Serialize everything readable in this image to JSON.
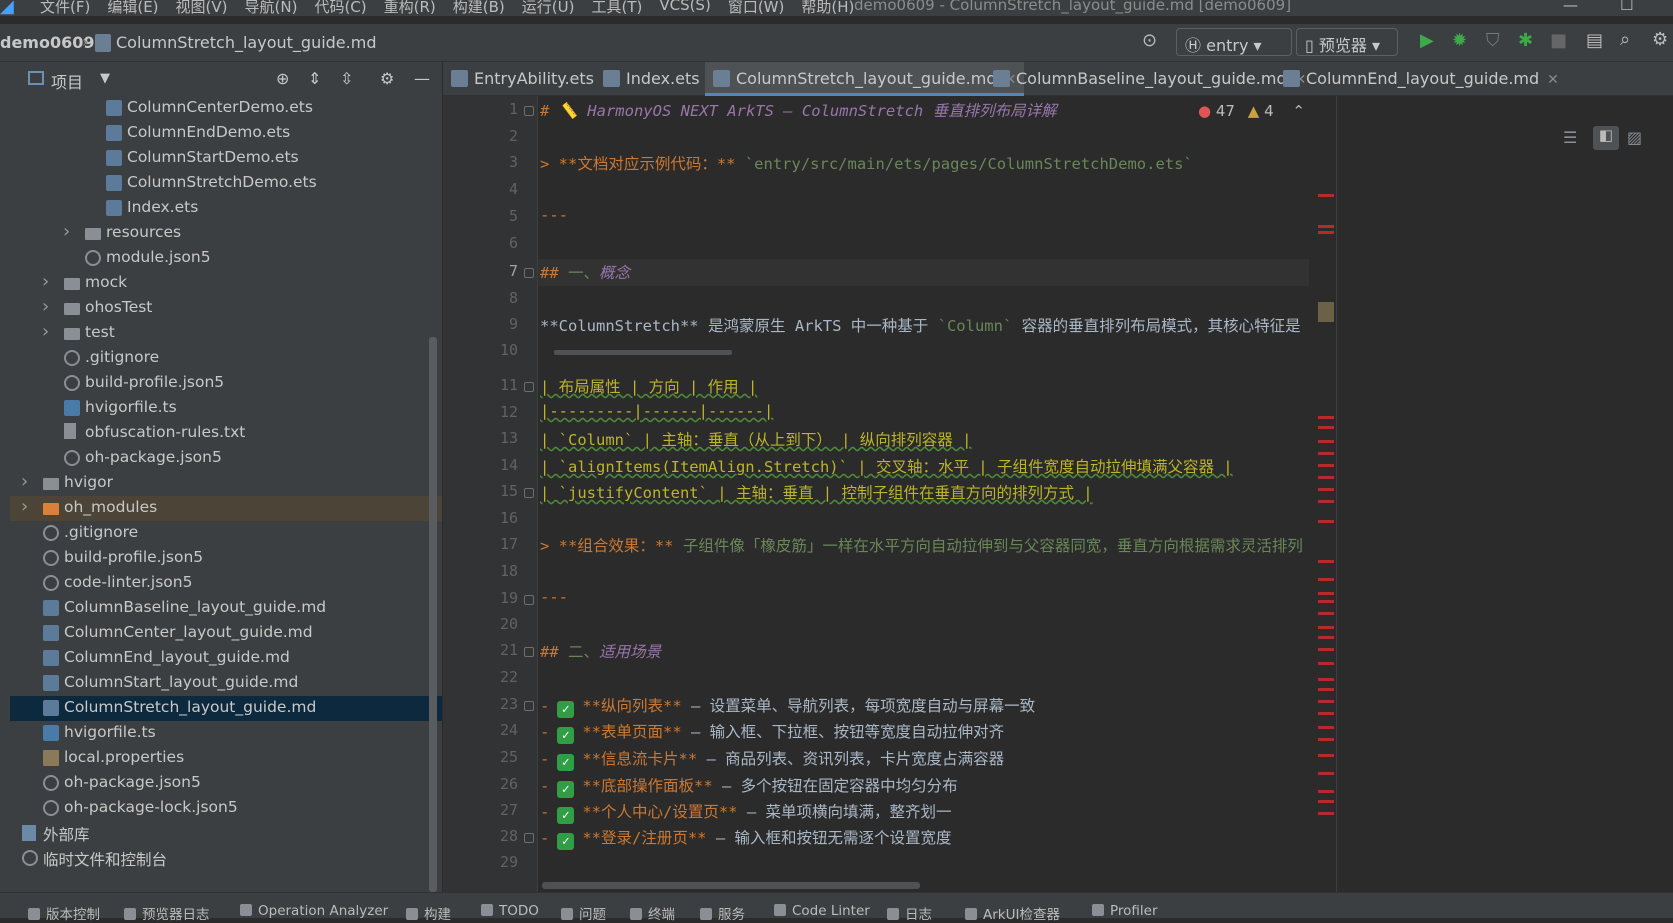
{
  "menubar": {
    "items": [
      "文件(F)",
      "编辑(E)",
      "视图(V)",
      "导航(N)",
      "代码(C)",
      "重构(R)",
      "构建(B)",
      "运行(U)",
      "工具(T)",
      "VCS(S)",
      "窗口(W)",
      "帮助(H)"
    ],
    "window_title": "demo0609 - ColumnStretch_layout_guide.md [demo0609]"
  },
  "navbar": {
    "project": "demo0609",
    "file": "ColumnStretch_layout_guide.md",
    "entry_combo": "entry",
    "previewer_combo": "预览器"
  },
  "project_panel": {
    "title": "项目",
    "tree": [
      {
        "name": "ColumnCenterDemo.ets",
        "icon": "ets-file-icon",
        "indent": 3
      },
      {
        "name": "ColumnEndDemo.ets",
        "icon": "ets-file-icon",
        "indent": 3
      },
      {
        "name": "ColumnStartDemo.ets",
        "icon": "ets-file-icon",
        "indent": 3
      },
      {
        "name": "ColumnStretchDemo.ets",
        "icon": "ets-file-icon",
        "indent": 3
      },
      {
        "name": "Index.ets",
        "icon": "ets-file-icon",
        "indent": 3
      },
      {
        "name": "resources",
        "icon": "folder-icon",
        "indent": 2,
        "arrow": true
      },
      {
        "name": "module.json5",
        "icon": "json-file-icon",
        "indent": 2
      },
      {
        "name": "mock",
        "icon": "folder-icon",
        "indent": 1,
        "arrow": true
      },
      {
        "name": "ohosTest",
        "icon": "folder-icon",
        "indent": 1,
        "arrow": true
      },
      {
        "name": "test",
        "icon": "folder-icon",
        "indent": 1,
        "arrow": true
      },
      {
        "name": ".gitignore",
        "icon": "json-file-icon",
        "indent": 1
      },
      {
        "name": "build-profile.json5",
        "icon": "json-file-icon",
        "indent": 1
      },
      {
        "name": "hvigorfile.ts",
        "icon": "ts-file-icon",
        "indent": 1
      },
      {
        "name": "obfuscation-rules.txt",
        "icon": "text-file-icon",
        "indent": 1
      },
      {
        "name": "oh-package.json5",
        "icon": "json-file-icon",
        "indent": 1
      },
      {
        "name": "hvigor",
        "icon": "folder-icon",
        "indent": 0,
        "arrow": true
      },
      {
        "name": "oh_modules",
        "icon": "orange-folder-icon",
        "indent": 0,
        "arrow": true
      },
      {
        "name": ".gitignore",
        "icon": "json-file-icon",
        "indent": 0
      },
      {
        "name": "build-profile.json5",
        "icon": "json-file-icon",
        "indent": 0
      },
      {
        "name": "code-linter.json5",
        "icon": "json-file-icon",
        "indent": 0
      },
      {
        "name": "ColumnBaseline_layout_guide.md",
        "icon": "md-file-icon",
        "indent": 0
      },
      {
        "name": "ColumnCenter_layout_guide.md",
        "icon": "md-file-icon",
        "indent": 0
      },
      {
        "name": "ColumnEnd_layout_guide.md",
        "icon": "md-file-icon",
        "indent": 0
      },
      {
        "name": "ColumnStart_layout_guide.md",
        "icon": "md-file-icon",
        "indent": 0
      },
      {
        "name": "ColumnStretch_layout_guide.md",
        "icon": "md-file-icon",
        "indent": 0,
        "selected": true
      },
      {
        "name": "hvigorfile.ts",
        "icon": "ts-file-icon",
        "indent": 0
      },
      {
        "name": "local.properties",
        "icon": "properties-file-icon",
        "indent": 0
      },
      {
        "name": "oh-package.json5",
        "icon": "json-file-icon",
        "indent": 0
      },
      {
        "name": "oh-package-lock.json5",
        "icon": "json-file-icon",
        "indent": 0
      },
      {
        "name": "外部库",
        "icon": "library-icon",
        "indent": -1,
        "arrow": true
      },
      {
        "name": "临时文件和控制台",
        "icon": "scratch-icon",
        "indent": -1
      }
    ]
  },
  "tabs": [
    {
      "label": "EntryAbility.ets",
      "active": false
    },
    {
      "label": "Index.ets",
      "active": false
    },
    {
      "label": "ColumnStretch_layout_guide.md",
      "active": true
    },
    {
      "label": "ColumnBaseline_layout_guide.md",
      "active": false
    },
    {
      "label": "ColumnEnd_layout_guide.md",
      "active": false
    }
  ],
  "inspections": {
    "errors": "47",
    "warnings": "4"
  },
  "editor": {
    "current_line": "7",
    "line_numbers": [
      "1",
      "2",
      "3",
      "4",
      "5",
      "6",
      "7",
      "8",
      "9",
      "10",
      "11",
      "12",
      "13",
      "14",
      "15",
      "16",
      "17",
      "18",
      "19",
      "20",
      "21",
      "22",
      "23",
      "24",
      "25",
      "26",
      "27",
      "28",
      "29"
    ],
    "lines": {
      "l1a": "# ",
      "l1b": "📏 HarmonyOS NEXT ArkTS — ColumnStretch ",
      "l1c": "垂直排列布局详解",
      "l3a": "> **",
      "l3b": "文档对应示例代码：",
      "l3c": "** ",
      "l3d": "`entry/src/main/ets/pages/ColumnStretchDemo.ets`",
      "l5": "---",
      "l7a": "## ",
      "l7b": "一、",
      "l7c": "概念",
      "l9a": "**ColumnStretch** ",
      "l9b": "是鸿蒙原生 ArkTS 中一种基于 ",
      "l9c": "`Column`",
      "l9d": " 容器的垂直排列布局模式，其核心特征是",
      "l11": "| 布局属性 | 方向 | 作用 |",
      "l12": "|---------|------|------|",
      "l13": "| `Column` | 主轴：垂直（从上到下） | 纵向排列容器 |",
      "l14": "| `alignItems(ItemAlign.Stretch)` | 交叉轴：水平 | 子组件宽度自动拉伸填满父容器 |",
      "l15": "| `justifyContent` | 主轴：垂直 | 控制子组件在垂直方向的排列方式 |",
      "l17a": "> **",
      "l17b": "组合效果：",
      "l17c": "** ",
      "l17d": "子组件像「橡皮筋」一样在水平方向自动拉伸到与父容器同宽，垂直方向根据需求灵活排列",
      "l19": "---",
      "l21a": "## ",
      "l21b": "二、",
      "l21c": "适用场景",
      "l23a": "**纵向列表**",
      "l23b": " — 设置菜单、导航列表，每项宽度自动与屏幕一致",
      "l24a": "**表单页面**",
      "l24b": " — 输入框、下拉框、按钮等宽度自动拉伸对齐",
      "l25a": "**信息流卡片**",
      "l25b": " — 商品列表、资讯列表，卡片宽度占满容器",
      "l26a": "**底部操作面板**",
      "l26b": " — 多个按钮在固定容器中均匀分布",
      "l27a": "**个人中心/设置页**",
      "l27b": " — 菜单项横向填满，整齐划一",
      "l28a": "**登录/注册页**",
      "l28b": " — 输入框和按钮无需逐个设置宽度",
      "dash": "-",
      "check": "✓"
    }
  },
  "statusbar": [
    "版本控制",
    "预览器日志",
    "Operation Analyzer",
    "构建",
    "TODO",
    "问题",
    "终端",
    "服务",
    "Code Linter",
    "日志",
    "ArkUI检查器",
    "Profiler"
  ],
  "colors": {
    "accent": "#4a88c7",
    "error": "#b52a2a",
    "run": "#3daa4a"
  }
}
